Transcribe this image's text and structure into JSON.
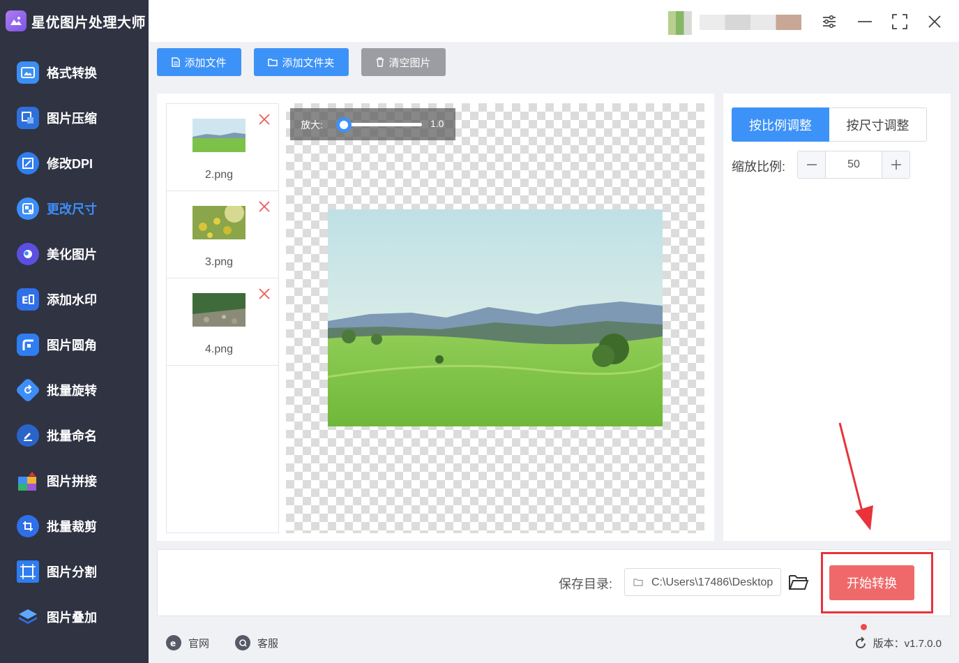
{
  "app": {
    "title": "星优图片处理大师"
  },
  "sidebar": {
    "items": [
      {
        "label": "格式转换",
        "icon": "image-convert-icon"
      },
      {
        "label": "图片压缩",
        "icon": "image-compress-icon"
      },
      {
        "label": "修改DPI",
        "icon": "dpi-icon"
      },
      {
        "label": "更改尺寸",
        "icon": "resize-icon",
        "active": true
      },
      {
        "label": "美化图片",
        "icon": "beautify-icon"
      },
      {
        "label": "添加水印",
        "icon": "watermark-icon"
      },
      {
        "label": "图片圆角",
        "icon": "rounded-corner-icon"
      },
      {
        "label": "批量旋转",
        "icon": "rotate-icon"
      },
      {
        "label": "批量命名",
        "icon": "rename-icon"
      },
      {
        "label": "图片拼接",
        "icon": "puzzle-icon"
      },
      {
        "label": "批量裁剪",
        "icon": "crop-icon"
      },
      {
        "label": "图片分割",
        "icon": "split-icon"
      },
      {
        "label": "图片叠加",
        "icon": "layers-icon"
      }
    ]
  },
  "toolbar": {
    "add_file": "添加文件",
    "add_folder": "添加文件夹",
    "clear_images": "清空图片"
  },
  "files": [
    {
      "name": "2.png"
    },
    {
      "name": "3.png"
    },
    {
      "name": "4.png"
    }
  ],
  "preview": {
    "zoom_label": "放大:",
    "zoom_value": "1.0"
  },
  "resize_panel": {
    "tab_ratio": "按比例调整",
    "tab_size": "按尺寸调整",
    "scale_label": "缩放比例:",
    "scale_value": "50"
  },
  "output": {
    "save_dir_label": "保存目录:",
    "save_dir_value": "C:\\Users\\17486\\Desktop",
    "start_button": "开始转换"
  },
  "footer": {
    "website": "官网",
    "support": "客服",
    "version": "版本：v1.7.0.0"
  },
  "colors": {
    "accent": "#3d92f7",
    "sidebar_bg": "#2f3342",
    "start_button": "#f0696a",
    "highlight": "#e8333a"
  }
}
